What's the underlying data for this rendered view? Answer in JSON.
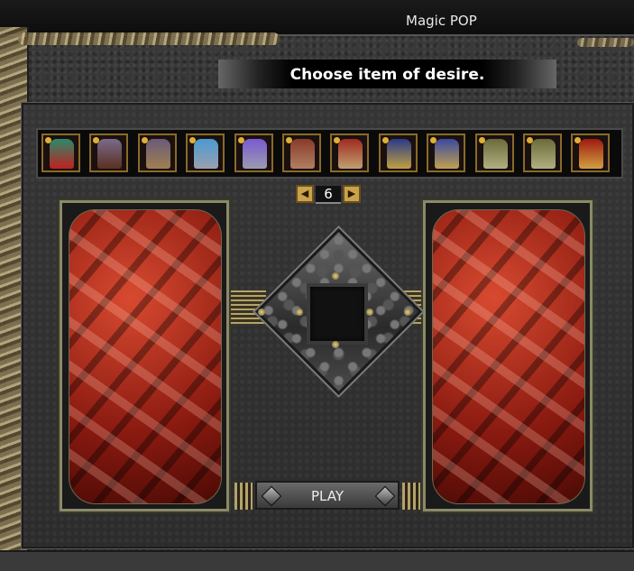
{
  "window": {
    "title": "Magic POP"
  },
  "banner": {
    "text": "Choose item of desire."
  },
  "items": [
    {
      "name": "item-slot-1",
      "color": "#2a8a6a",
      "accent": "#c02020"
    },
    {
      "name": "item-slot-2",
      "color": "#7a6a8a",
      "accent": "#5a3020"
    },
    {
      "name": "item-slot-3",
      "color": "#6a5a7a",
      "accent": "#a08050"
    },
    {
      "name": "item-slot-4",
      "color": "#4a9ad0",
      "accent": "#9aa0b0"
    },
    {
      "name": "item-slot-5",
      "color": "#7a5ad0",
      "accent": "#9a9ab0"
    },
    {
      "name": "item-slot-6",
      "color": "#8a3a2a",
      "accent": "#b08060"
    },
    {
      "name": "item-slot-7",
      "color": "#a02a20",
      "accent": "#c0a070"
    },
    {
      "name": "item-slot-8",
      "color": "#2a3a8a",
      "accent": "#c0a040"
    },
    {
      "name": "item-slot-9",
      "color": "#3a4aa0",
      "accent": "#c0a050"
    },
    {
      "name": "item-slot-10",
      "color": "#6a6a3a",
      "accent": "#b0b080"
    },
    {
      "name": "item-slot-11",
      "color": "#6a6a3a",
      "accent": "#b0b080"
    },
    {
      "name": "item-slot-12",
      "color": "#a01a10",
      "accent": "#d0a040"
    }
  ],
  "pager": {
    "prev_icon": "◀",
    "next_icon": "▶",
    "page": "6"
  },
  "play": {
    "label": "PLAY"
  }
}
